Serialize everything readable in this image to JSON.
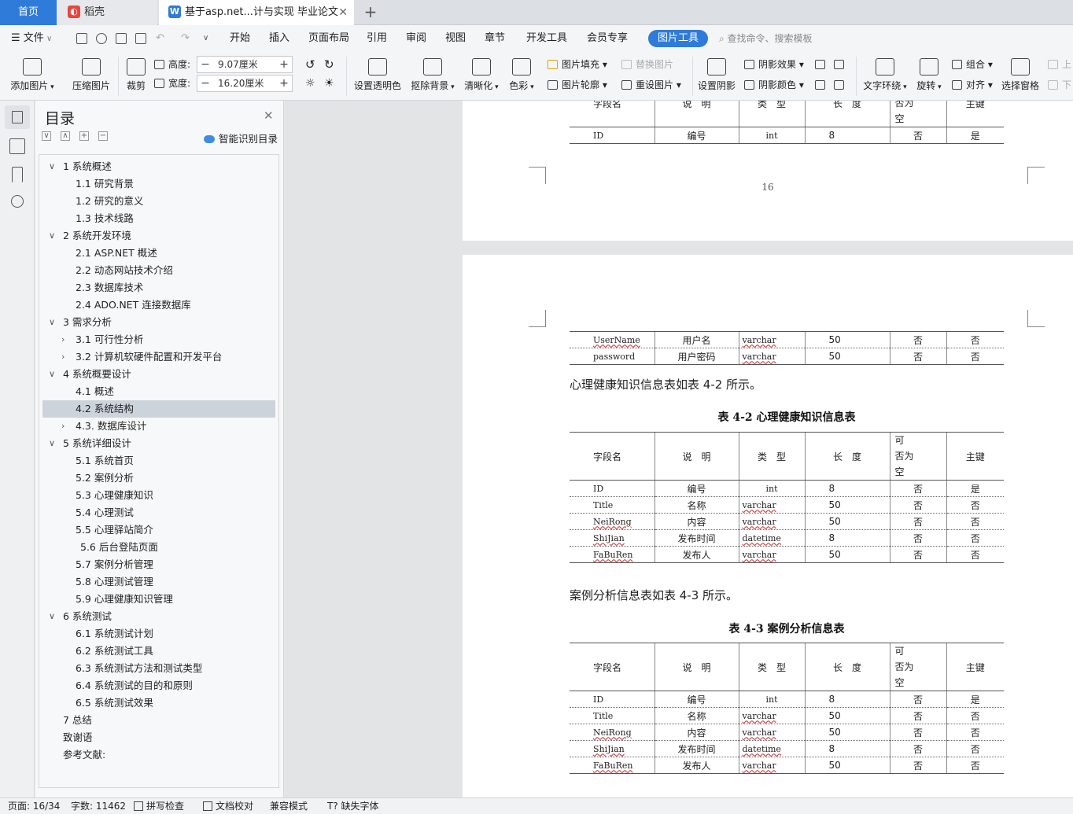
{
  "tabs": {
    "home": "首页",
    "daoke": "稻壳",
    "doc": "基于asp.net...计与实现 毕业论文"
  },
  "menu": {
    "file": "文件",
    "items": [
      "开始",
      "插入",
      "页面布局",
      "引用",
      "审阅",
      "视图",
      "章节",
      "开发工具",
      "会员专享"
    ],
    "active": "图片工具",
    "search": "查找命令、搜索模板"
  },
  "ribbon": {
    "add_image": "添加图片",
    "compress": "压缩图片",
    "crop": "裁剪",
    "height_label": "高度:",
    "height_value": "9.07厘米",
    "width_label": "宽度:",
    "width_value": "16.20厘米",
    "transparent": "设置透明色",
    "remove_bg": "抠除背景",
    "sharpen": "清晰化",
    "color": "色彩",
    "fill": "图片填充",
    "outline": "图片轮廓",
    "replace": "替换图片",
    "reset": "重设图片",
    "shadow": "设置阴影",
    "shadow_effect": "阴影效果",
    "shadow_color": "阴影颜色",
    "wrap": "文字环绕",
    "rotate": "旋转",
    "group": "组合",
    "align": "对齐",
    "select_pane": "选择窗格",
    "up": "上",
    "down": "下"
  },
  "toc": {
    "title": "目录",
    "smart": "智能识别目录",
    "items": [
      {
        "label": "1  系统概述",
        "arrow": "v"
      },
      {
        "label": "1.1  研究背景",
        "arrow": ""
      },
      {
        "label": "1.2 研究的意义",
        "arrow": ""
      },
      {
        "label": "1.3 技术线路",
        "arrow": ""
      },
      {
        "label": "2  系统开发环境",
        "arrow": "v"
      },
      {
        "label": "2.1 ASP.NET 概述",
        "arrow": ""
      },
      {
        "label": "2.2 动态网站技术介绍",
        "arrow": ""
      },
      {
        "label": "2.3  数据库技术",
        "arrow": ""
      },
      {
        "label": "2.4    ADO.NET 连接数据库",
        "arrow": ""
      },
      {
        "label": "3  需求分析",
        "arrow": "v"
      },
      {
        "label": "3.1 可行性分析",
        "arrow": ">"
      },
      {
        "label": "3.2 计算机软硬件配置和开发平台",
        "arrow": ">"
      },
      {
        "label": "4 系统概要设计",
        "arrow": "v"
      },
      {
        "label": "4.1  概述",
        "arrow": ""
      },
      {
        "label": "4.2  系统结构",
        "arrow": ""
      },
      {
        "label": "4.3.  数据库设计",
        "arrow": ">"
      },
      {
        "label": "5 系统详细设计",
        "arrow": "v"
      },
      {
        "label": "5.1  系统首页",
        "arrow": ""
      },
      {
        "label": "5.2 案例分析",
        "arrow": ""
      },
      {
        "label": "5.3 心理健康知识",
        "arrow": ""
      },
      {
        "label": "5.4 心理测试",
        "arrow": ""
      },
      {
        "label": "5.5 心理驿站简介",
        "arrow": ""
      },
      {
        "label": "5.6 后台登陆页面",
        "arrow": ""
      },
      {
        "label": "5.7 案例分析管理",
        "arrow": ""
      },
      {
        "label": "5.8 心理测试管理",
        "arrow": ""
      },
      {
        "label": "5.9 心理健康知识管理",
        "arrow": ""
      },
      {
        "label": "6 系统测试",
        "arrow": "v"
      },
      {
        "label": "6.1 系统测试计划",
        "arrow": ""
      },
      {
        "label": "6.2  系统测试工具",
        "arrow": ""
      },
      {
        "label": "6.3 系统测试方法和测试类型",
        "arrow": ""
      },
      {
        "label": "6.4 系统测试的目的和原则",
        "arrow": ""
      },
      {
        "label": "6.5 系统测试效果",
        "arrow": ""
      },
      {
        "label": "7  总结",
        "arrow": ""
      },
      {
        "label": "致谢语",
        "arrow": ""
      },
      {
        "label": "参考文献:",
        "arrow": ""
      }
    ],
    "selected": "4.2  系统结构"
  },
  "doc": {
    "header": [
      "字段名",
      "说　明",
      "类　型",
      "长　度",
      "可　否为空",
      "主键"
    ],
    "page16_rows": [
      [
        "ID",
        "编号",
        "int",
        "8",
        "否",
        "是"
      ]
    ],
    "page_number": "16",
    "page17_rows": [
      [
        "UserName",
        "用户名",
        "varchar",
        "50",
        "否",
        "否"
      ],
      [
        "password",
        "用户密码",
        "varchar",
        "50",
        "否",
        "否"
      ]
    ],
    "para_42": "心理健康知识信息表如表 4-2 所示。",
    "title_42": "表 4-2 心理健康知识信息表",
    "table_42_rows": [
      [
        "ID",
        "编号",
        "int",
        "8",
        "否",
        "是"
      ],
      [
        "Title",
        "名称",
        "varchar",
        "50",
        "否",
        "否"
      ],
      [
        "NeiRong",
        "内容",
        "varchar",
        "50",
        "否",
        "否"
      ],
      [
        "ShiJian",
        "发布时间",
        "datetime",
        "8",
        "否",
        "否"
      ],
      [
        "FaBuRen",
        "发布人",
        "varchar",
        "50",
        "否",
        "否"
      ]
    ],
    "para_43": "案例分析信息表如表 4-3 所示。",
    "title_43": "表 4-3 案例分析信息表",
    "table_43_rows": [
      [
        "ID",
        "编号",
        "int",
        "8",
        "否",
        "是"
      ],
      [
        "Title",
        "名称",
        "varchar",
        "50",
        "否",
        "否"
      ],
      [
        "NeiRong",
        "内容",
        "varchar",
        "50",
        "否",
        "否"
      ],
      [
        "ShiJian",
        "发布时间",
        "datetime",
        "8",
        "否",
        "否"
      ],
      [
        "FaBuRen",
        "发布人",
        "varchar",
        "50",
        "否",
        "否"
      ]
    ]
  },
  "status": {
    "page": "页面: 16/34",
    "words": "字数: 11462",
    "spell": "拼写检查",
    "proof": "文档校对",
    "compat": "兼容模式",
    "font": "缺失字体"
  },
  "colors": {
    "accent": "#2f7bd9",
    "selected": "#ccd3db"
  }
}
